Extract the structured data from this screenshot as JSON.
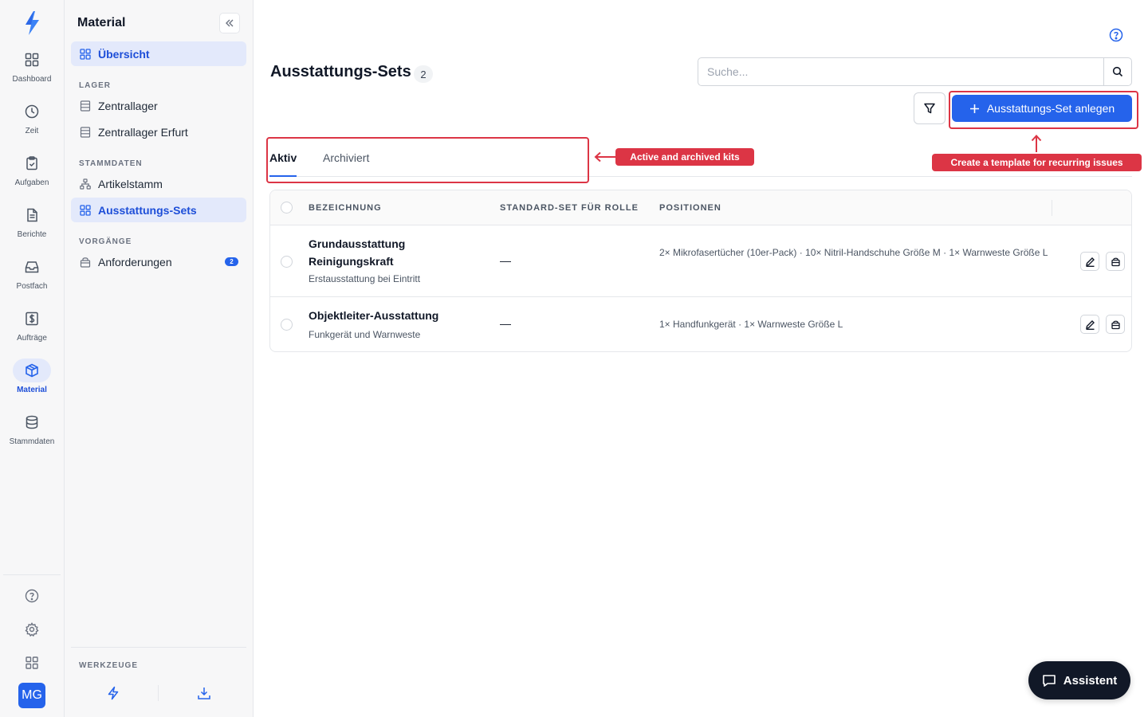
{
  "rail": {
    "items": [
      {
        "label": "Dashboard",
        "icon": "dashboard-icon"
      },
      {
        "label": "Zeit",
        "icon": "clock-icon"
      },
      {
        "label": "Aufgaben",
        "icon": "clipboard-icon"
      },
      {
        "label": "Berichte",
        "icon": "document-icon"
      },
      {
        "label": "Postfach",
        "icon": "inbox-icon"
      },
      {
        "label": "Aufträge",
        "icon": "dollar-icon"
      },
      {
        "label": "Material",
        "icon": "box-icon",
        "active": true
      },
      {
        "label": "Stammdaten",
        "icon": "database-icon"
      }
    ],
    "avatar": "MG"
  },
  "sidebar": {
    "title": "Material",
    "overview": "Übersicht",
    "section_lager": "LAGER",
    "lager_items": [
      "Zentrallager",
      "Zentrallager Erfurt"
    ],
    "section_stammdaten": "STAMMDATEN",
    "stammdaten_items": [
      "Artikelstamm",
      "Ausstattungs-Sets"
    ],
    "section_vorgaenge": "VORGÄNGE",
    "vorgaenge_items": [
      {
        "label": "Anforderungen",
        "badge": "2"
      }
    ],
    "tools_label": "WERKZEUGE"
  },
  "main": {
    "title": "Ausstattungs-Sets",
    "count": "2",
    "search_placeholder": "Suche...",
    "create_button": "Ausstattungs-Set anlegen",
    "tabs": [
      "Aktiv",
      "Archiviert"
    ],
    "columns": [
      "BEZEICHNUNG",
      "STANDARD-SET FÜR ROLLE",
      "POSITIONEN"
    ],
    "rows": [
      {
        "name": "Grundausstattung Reinigungskraft",
        "description": "Erstausstattung bei Eintritt",
        "role": "—",
        "positions": "2× Mikrofasertücher (10er-Pack) · 10× Nitril-Handschuhe Größe M · 1× Warnweste Größe L"
      },
      {
        "name": "Objektleiter-Ausstattung",
        "description": "Funkgerät und Warnweste",
        "role": "—",
        "positions": "1× Handfunkgerät · 1× Warnweste Größe L"
      }
    ]
  },
  "annotations": {
    "tabs_note": "Active and archived kits",
    "create_note": "Create a template for recurring issues"
  },
  "assistant": {
    "label": "Assistent"
  },
  "colors": {
    "accent": "#2563eb",
    "annotation": "#dc3545",
    "assistant_bg": "#111827"
  }
}
